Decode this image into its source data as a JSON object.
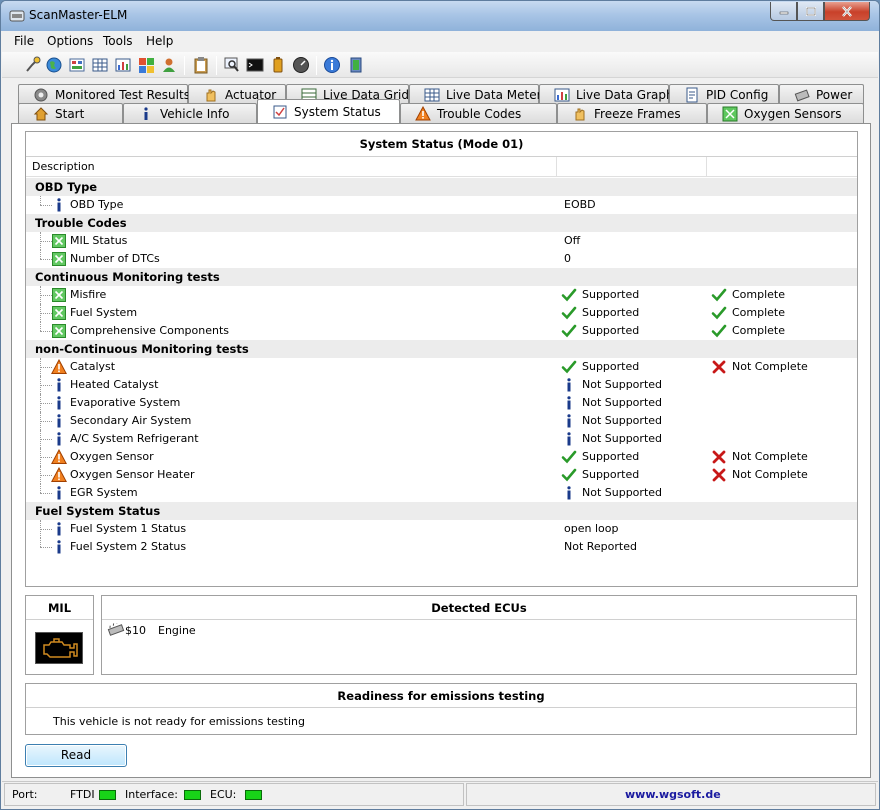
{
  "window": {
    "title": "ScanMaster-ELM"
  },
  "menu": [
    "File",
    "Options",
    "Tools",
    "Help"
  ],
  "toolbar": {
    "icons": [
      "connect-icon",
      "globe-icon",
      "vehicle-info-icon",
      "grid-icon",
      "graph-icon",
      "windows-icon",
      "user-icon",
      "clipboard-icon",
      "search-icon",
      "terminal-icon",
      "battery-icon",
      "gauge-icon",
      "info-icon",
      "exit-icon"
    ]
  },
  "tabs": {
    "top": [
      "Monitored Test Results",
      "Actuator",
      "Live Data Grid",
      "Live Data Meter",
      "Live Data Graph",
      "PID Config",
      "Power"
    ],
    "bottom": [
      "Start",
      "Vehicle Info",
      "System Status",
      "Trouble Codes",
      "Freeze Frames",
      "Oxygen Sensors"
    ],
    "active": "System Status"
  },
  "system_status": {
    "title": "System Status (Mode 01)",
    "col_description": "Description",
    "sections": [
      {
        "title": "OBD Type",
        "rows": [
          {
            "label": "OBD Type",
            "icon": "info",
            "v1": "EOBD"
          }
        ]
      },
      {
        "title": "Trouble Codes",
        "rows": [
          {
            "label": "MIL Status",
            "icon": "ok-green",
            "v1": "Off"
          },
          {
            "label": "Number of DTCs",
            "icon": "ok-green",
            "v1": "0"
          }
        ]
      },
      {
        "title": "Continuous Monitoring tests",
        "rows": [
          {
            "label": "Misfire",
            "icon": "ok-green",
            "v1_icon": "check",
            "v1": "Supported",
            "v2_icon": "check",
            "v2": "Complete"
          },
          {
            "label": "Fuel System",
            "icon": "ok-green",
            "v1_icon": "check",
            "v1": "Supported",
            "v2_icon": "check",
            "v2": "Complete"
          },
          {
            "label": "Comprehensive Components",
            "icon": "ok-green",
            "v1_icon": "check",
            "v1": "Supported",
            "v2_icon": "check",
            "v2": "Complete"
          }
        ]
      },
      {
        "title": "non-Continuous Monitoring tests",
        "rows": [
          {
            "label": "Catalyst",
            "icon": "warning",
            "v1_icon": "check",
            "v1": "Supported",
            "v2_icon": "cross",
            "v2": "Not Complete"
          },
          {
            "label": "Heated Catalyst",
            "icon": "info",
            "v1_icon": "info",
            "v1": "Not Supported"
          },
          {
            "label": "Evaporative System",
            "icon": "info",
            "v1_icon": "info",
            "v1": "Not Supported"
          },
          {
            "label": "Secondary Air System",
            "icon": "info",
            "v1_icon": "info",
            "v1": "Not Supported"
          },
          {
            "label": "A/C System Refrigerant",
            "icon": "info",
            "v1_icon": "info",
            "v1": "Not Supported"
          },
          {
            "label": "Oxygen Sensor",
            "icon": "warning",
            "v1_icon": "check",
            "v1": "Supported",
            "v2_icon": "cross",
            "v2": "Not Complete"
          },
          {
            "label": "Oxygen Sensor Heater",
            "icon": "warning",
            "v1_icon": "check",
            "v1": "Supported",
            "v2_icon": "cross",
            "v2": "Not Complete"
          },
          {
            "label": "EGR System",
            "icon": "info",
            "v1_icon": "info",
            "v1": "Not Supported"
          }
        ]
      },
      {
        "title": "Fuel System Status",
        "rows": [
          {
            "label": "Fuel System 1 Status",
            "icon": "info",
            "v1": "open loop"
          },
          {
            "label": "Fuel System 2 Status",
            "icon": "info",
            "v1": "Not Reported"
          }
        ]
      }
    ]
  },
  "mil": {
    "title": "MIL",
    "icon": "engine-warning-icon"
  },
  "ecus": {
    "title": "Detected ECUs",
    "items": [
      {
        "id": "$10",
        "name": "Engine"
      }
    ]
  },
  "readiness": {
    "title": "Readiness for emissions testing",
    "text": "This vehicle is not ready for emissions testing"
  },
  "buttons": {
    "read": "Read"
  },
  "statusbar": {
    "port_label": "Port:",
    "port_value": "FTDI",
    "interface_label": "Interface:",
    "ecu_label": "ECU:",
    "website": "www.wgsoft.de",
    "led_color": "#18d418"
  }
}
